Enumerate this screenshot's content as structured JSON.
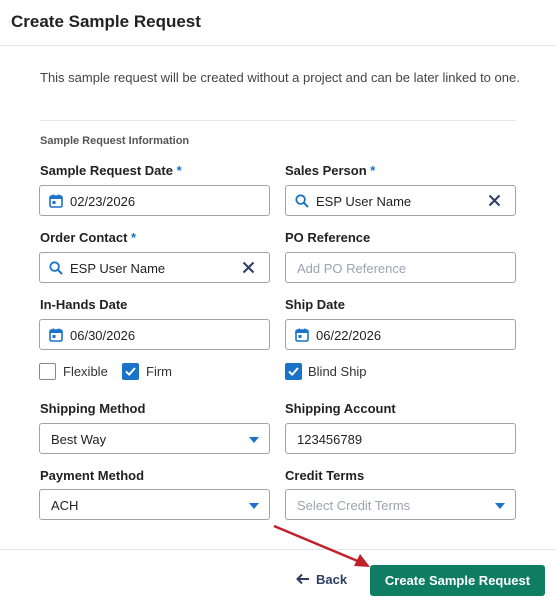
{
  "header": {
    "title": "Create Sample Request"
  },
  "intro": {
    "text": "This sample request will be created without a project and can be later linked to one."
  },
  "section": {
    "title": "Sample Request Information"
  },
  "fields": {
    "sample_request_date": {
      "label": "Sample Request Date",
      "required": "*",
      "value": "02/23/2026"
    },
    "sales_person": {
      "label": "Sales Person",
      "required": "*",
      "value": "ESP User Name"
    },
    "order_contact": {
      "label": "Order Contact",
      "required": "*",
      "value": "ESP User Name"
    },
    "po_reference": {
      "label": "PO Reference",
      "placeholder": "Add PO Reference"
    },
    "in_hands_date": {
      "label": "In-Hands Date",
      "value": "06/30/2026"
    },
    "ship_date": {
      "label": "Ship Date",
      "value": "06/22/2026"
    },
    "shipping_method": {
      "label": "Shipping Method",
      "value": "Best Way"
    },
    "shipping_account": {
      "label": "Shipping Account",
      "value": "123456789"
    },
    "payment_method": {
      "label": "Payment Method",
      "value": "ACH"
    },
    "credit_terms": {
      "label": "Credit Terms",
      "placeholder": "Select Credit Terms"
    }
  },
  "checkboxes": {
    "flexible": {
      "label": "Flexible",
      "checked": false
    },
    "firm": {
      "label": "Firm",
      "checked": true
    },
    "blind_ship": {
      "label": "Blind Ship",
      "checked": true
    }
  },
  "footer": {
    "back_label": "Back",
    "submit_label": "Create Sample Request"
  },
  "colors": {
    "accent": "#1a73c8",
    "primary": "#0e7d61",
    "annotation_arrow": "#c0202a"
  }
}
